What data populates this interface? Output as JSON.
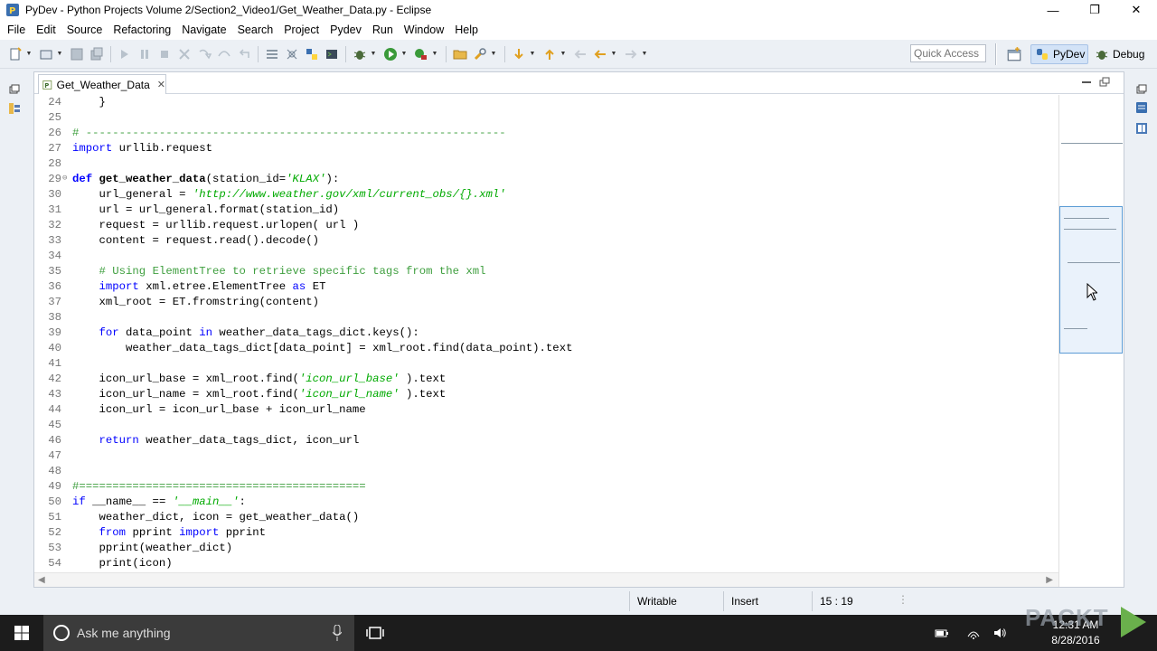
{
  "window": {
    "title": "PyDev - Python Projects Volume 2/Section2_Video1/Get_Weather_Data.py - Eclipse",
    "controls": {
      "minimize": "—",
      "restore": "❐",
      "close": "✕"
    }
  },
  "menu": [
    "File",
    "Edit",
    "Source",
    "Refactoring",
    "Navigate",
    "Search",
    "Project",
    "Pydev",
    "Run",
    "Window",
    "Help"
  ],
  "toolbar": {
    "quick_access_placeholder": "Quick Access",
    "perspectives": [
      {
        "label": "PyDev",
        "active": true
      },
      {
        "label": "Debug",
        "active": false
      }
    ]
  },
  "editor": {
    "tab_label": "Get_Weather_Data",
    "tab_close": "✕",
    "lines": [
      {
        "n": "24",
        "text": "    }"
      },
      {
        "n": "25",
        "text": ""
      },
      {
        "n": "26",
        "text": "# ---------------------------------------------------------------"
      },
      {
        "n": "27",
        "text": "import urllib.request"
      },
      {
        "n": "28",
        "text": ""
      },
      {
        "n": "29",
        "text": "def get_weather_data(station_id='KLAX'):"
      },
      {
        "n": "30",
        "text": "    url_general = 'http://www.weather.gov/xml/current_obs/{}.xml'"
      },
      {
        "n": "31",
        "text": "    url = url_general.format(station_id)"
      },
      {
        "n": "32",
        "text": "    request = urllib.request.urlopen( url )"
      },
      {
        "n": "33",
        "text": "    content = request.read().decode()"
      },
      {
        "n": "34",
        "text": ""
      },
      {
        "n": "35",
        "text": "    # Using ElementTree to retrieve specific tags from the xml"
      },
      {
        "n": "36",
        "text": "    import xml.etree.ElementTree as ET"
      },
      {
        "n": "37",
        "text": "    xml_root = ET.fromstring(content)"
      },
      {
        "n": "38",
        "text": ""
      },
      {
        "n": "39",
        "text": "    for data_point in weather_data_tags_dict.keys():"
      },
      {
        "n": "40",
        "text": "        weather_data_tags_dict[data_point] = xml_root.find(data_point).text"
      },
      {
        "n": "41",
        "text": ""
      },
      {
        "n": "42",
        "text": "    icon_url_base = xml_root.find('icon_url_base' ).text"
      },
      {
        "n": "43",
        "text": "    icon_url_name = xml_root.find('icon_url_name' ).text"
      },
      {
        "n": "44",
        "text": "    icon_url = icon_url_base + icon_url_name"
      },
      {
        "n": "45",
        "text": ""
      },
      {
        "n": "46",
        "text": "    return weather_data_tags_dict, icon_url"
      },
      {
        "n": "47",
        "text": ""
      },
      {
        "n": "48",
        "text": ""
      },
      {
        "n": "49",
        "text": "#==========================================="
      },
      {
        "n": "50",
        "text": "if __name__ == '__main__':"
      },
      {
        "n": "51",
        "text": "    weather_dict, icon = get_weather_data()"
      },
      {
        "n": "52",
        "text": "    from pprint import pprint"
      },
      {
        "n": "53",
        "text": "    pprint(weather_dict)"
      },
      {
        "n": "54",
        "text": "    print(icon)"
      }
    ]
  },
  "status": {
    "writable": "Writable",
    "insert": "Insert",
    "position": "15 : 19"
  },
  "taskbar": {
    "search_placeholder": "Ask me anything",
    "time": "12:31 AM",
    "date": "8/28/2016"
  },
  "watermark": "PACKT",
  "colors": {
    "keyword": "#0000ff",
    "string": "#00aa00",
    "comment": "#3f9f3f",
    "accent": "#d3e3f7"
  }
}
